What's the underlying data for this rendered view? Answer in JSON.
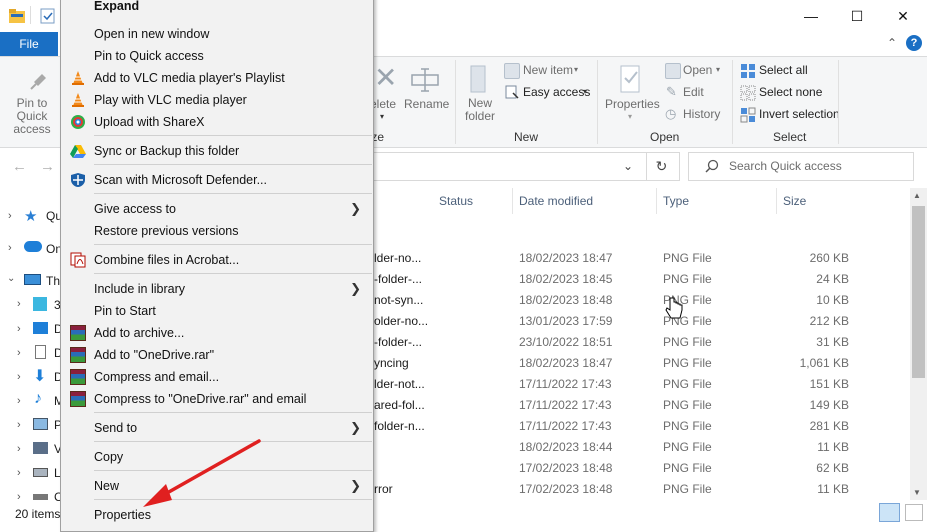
{
  "window": {
    "minimize": "—",
    "maximize": "☐",
    "close": "✕"
  },
  "ribbon": {
    "file_tab": "File",
    "pin_label": "Pin to Quick access",
    "delete_label": "Delete",
    "rename_label": "Rename",
    "organize_group": "Organize",
    "new_folder_label": "New folder",
    "new_item_label": "New item",
    "easy_access_label": "Easy access",
    "new_group": "New",
    "properties_label": "Properties",
    "open_label": "Open",
    "edit_label": "Edit",
    "history_label": "History",
    "open_group": "Open",
    "select_all_label": "Select all",
    "select_none_label": "Select none",
    "invert_selection_label": "Invert selection",
    "select_group": "Select"
  },
  "nav": {
    "back": "←",
    "forward": "→",
    "refresh": "↻",
    "search_placeholder": "Search Quick access"
  },
  "columns": {
    "status": "Status",
    "date": "Date modified",
    "type": "Type",
    "size": "Size"
  },
  "files": [
    {
      "name": "lder-no...",
      "date": "18/02/2023 18:47",
      "type": "PNG File",
      "size": "260 KB"
    },
    {
      "name": "-folder-...",
      "date": "18/02/2023 18:45",
      "type": "PNG File",
      "size": "24 KB"
    },
    {
      "name": "not-syn...",
      "date": "18/02/2023 18:48",
      "type": "PNG File",
      "size": "10 KB"
    },
    {
      "name": "older-no...",
      "date": "13/01/2023 17:59",
      "type": "PNG File",
      "size": "212 KB"
    },
    {
      "name": "-folder-...",
      "date": "23/10/2022 18:51",
      "type": "PNG File",
      "size": "31 KB"
    },
    {
      "name": "yncing",
      "date": "18/02/2023 18:47",
      "type": "PNG File",
      "size": "1,061 KB"
    },
    {
      "name": "lder-not...",
      "date": "17/11/2022 17:43",
      "type": "PNG File",
      "size": "151 KB"
    },
    {
      "name": "ared-fol...",
      "date": "17/11/2022 17:43",
      "type": "PNG File",
      "size": "149 KB"
    },
    {
      "name": "folder-n...",
      "date": "17/11/2022 17:43",
      "type": "PNG File",
      "size": "281 KB"
    },
    {
      "name": "",
      "date": "18/02/2023 18:44",
      "type": "PNG File",
      "size": "11 KB"
    },
    {
      "name": "",
      "date": "17/02/2023 18:48",
      "type": "PNG File",
      "size": "62 KB"
    },
    {
      "name": "rror",
      "date": "17/02/2023 18:48",
      "type": "PNG File",
      "size": "11 KB"
    }
  ],
  "sidebar": {
    "quick_access": "Qu",
    "onedrive": "On",
    "this_pc": "Th",
    "c3d": "3",
    "desktop": "D",
    "documents": "D",
    "downloads": "D",
    "music": "M",
    "pictures": "P",
    "videos": "V",
    "local": "L",
    "other": "C"
  },
  "status": {
    "items_count": "20 items"
  },
  "menu": {
    "expand": "Expand",
    "open_new_window": "Open in new window",
    "pin_quick": "Pin to Quick access",
    "vlc_playlist": "Add to VLC media player's Playlist",
    "vlc_play": "Play with VLC media player",
    "sharex": "Upload with ShareX",
    "gdrive": "Sync or Backup this folder",
    "defender": "Scan with Microsoft Defender...",
    "give_access": "Give access to",
    "restore": "Restore previous versions",
    "acrobat": "Combine files in Acrobat...",
    "include_library": "Include in library",
    "pin_start": "Pin to Start",
    "add_archive": "Add to archive...",
    "add_rar": "Add to \"OneDrive.rar\"",
    "compress_email": "Compress and email...",
    "compress_rar_email": "Compress to \"OneDrive.rar\" and email",
    "send_to": "Send to",
    "copy": "Copy",
    "new": "New",
    "properties": "Properties"
  },
  "colors": {
    "accent": "#1a6fc4",
    "annotation_arrow": "#e02020"
  }
}
